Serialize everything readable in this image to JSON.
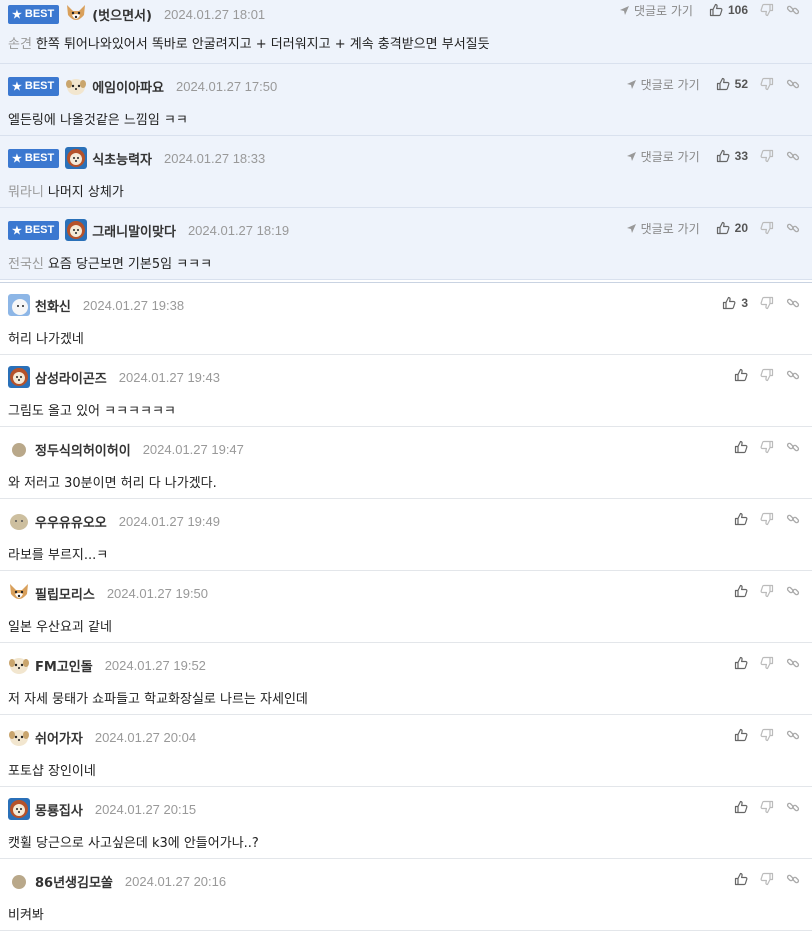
{
  "labels": {
    "best": "BEST",
    "reply_to": "댓글로 가기"
  },
  "colors": {
    "best_bg": "#eef3fb",
    "badge": "#3b78d0"
  },
  "comments": [
    {
      "best": true,
      "avatar": "dog-icon",
      "nick": "(벗으면서)",
      "date": "2024.01.27 18:01",
      "mention": "손견",
      "text": "한쪽 튀어나와있어서 똑바로 안굴려지고 + 더러워지고 + 계속 충격받으면 부서질듯",
      "likes": "106"
    },
    {
      "best": true,
      "avatar": "face-icon",
      "nick": "에임이아파요",
      "date": "2024.01.27 17:50",
      "mention": "",
      "text": "엘든링에 나올것같은 느낌임 ㅋㅋ",
      "likes": "52"
    },
    {
      "best": true,
      "avatar": "lion-icon",
      "nick": "식초능력자",
      "date": "2024.01.27 18:33",
      "mention": "뭐라니",
      "text": "나머지 상체가",
      "likes": "33"
    },
    {
      "best": true,
      "avatar": "lion-icon",
      "nick": "그래니말이맞다",
      "date": "2024.01.27 18:19",
      "mention": "전국신",
      "text": "요즘 당근보면 기본5임 ㅋㅋㅋ",
      "likes": "20"
    },
    {
      "best": false,
      "avatar": "bear-icon",
      "nick": "천화신",
      "date": "2024.01.27 19:38",
      "mention": "",
      "text": "허리 나가겠네",
      "likes": "3"
    },
    {
      "best": false,
      "avatar": "lion-icon",
      "nick": "삼성라이곤즈",
      "date": "2024.01.27 19:43",
      "mention": "",
      "text": "그림도 올고 있어 ㅋㅋㅋㅋㅋㅋ",
      "likes": ""
    },
    {
      "best": false,
      "avatar": "dot-icon",
      "nick": "정두식의허이허이",
      "date": "2024.01.27 19:47",
      "mention": "",
      "text": "와 저러고 30분이면 허리 다 나가겠다.",
      "likes": ""
    },
    {
      "best": false,
      "avatar": "blob-icon",
      "nick": "우우유유오오",
      "date": "2024.01.27 19:49",
      "mention": "",
      "text": "라보를 부르지...ㅋ",
      "likes": ""
    },
    {
      "best": false,
      "avatar": "dog-icon",
      "nick": "필립모리스",
      "date": "2024.01.27 19:50",
      "mention": "",
      "text": "일본 우산요괴 같네",
      "likes": ""
    },
    {
      "best": false,
      "avatar": "face-icon",
      "nick": "FM고인돌",
      "date": "2024.01.27 19:52",
      "mention": "",
      "text": "저 자세 뭉태가 쇼파들고 학교화장실로 나르는 자세인데",
      "likes": ""
    },
    {
      "best": false,
      "avatar": "face-icon",
      "nick": "쉬어가자",
      "date": "2024.01.27 20:04",
      "mention": "",
      "text": "포토샵 장인이네",
      "likes": ""
    },
    {
      "best": false,
      "avatar": "lion-icon",
      "nick": "몽룡집사",
      "date": "2024.01.27 20:15",
      "mention": "",
      "text": "캣휠 당근으로 사고싶은데 k3에 안들어가나..?",
      "likes": ""
    },
    {
      "best": false,
      "avatar": "dot-icon",
      "nick": "86년생김모쏠",
      "date": "2024.01.27 20:16",
      "mention": "",
      "text": "비켜봐",
      "likes": ""
    }
  ]
}
